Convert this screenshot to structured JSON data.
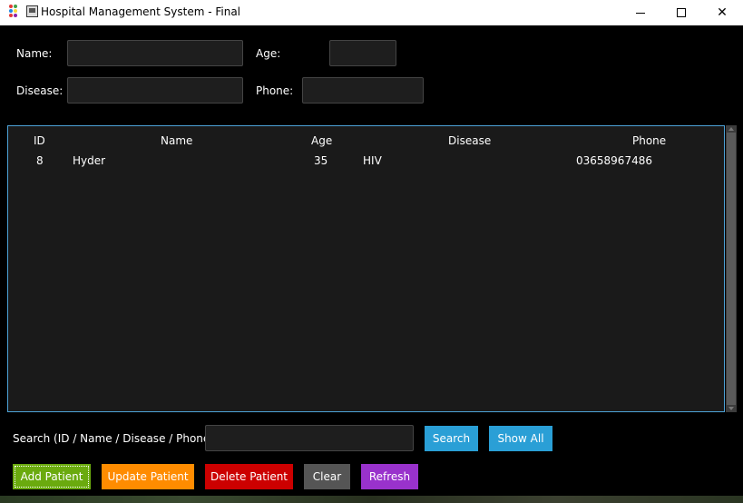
{
  "window": {
    "title": "Hospital Management System - Final",
    "minimize_glyph": "",
    "maximize_glyph": "",
    "close_glyph": "✕"
  },
  "form": {
    "name_label": "Name:",
    "name_value": "",
    "age_label": "Age:",
    "age_value": "",
    "disease_label": "Disease:",
    "disease_value": "",
    "phone_label": "Phone:",
    "phone_value": ""
  },
  "table": {
    "columns": [
      "ID",
      "Name",
      "Age",
      "Disease",
      "Phone"
    ],
    "rows": [
      {
        "id": "8",
        "name": "Hyder",
        "age": "35",
        "disease": "HIV",
        "phone": "03658967486"
      }
    ]
  },
  "search": {
    "label": "Search (ID / Name / Disease / Phone):",
    "value": "",
    "search_button": "Search",
    "show_all_button": "Show All"
  },
  "actions": {
    "add": "Add Patient",
    "update": "Update Patient",
    "delete": "Delete Patient",
    "clear": "Clear",
    "refresh": "Refresh"
  },
  "colors": {
    "add": "#6aaa0e",
    "update": "#ff8c00",
    "delete": "#cc0000",
    "clear": "#555555",
    "refresh": "#9932cc",
    "search": "#2a9fd6",
    "table_border": "#4da3d8"
  }
}
